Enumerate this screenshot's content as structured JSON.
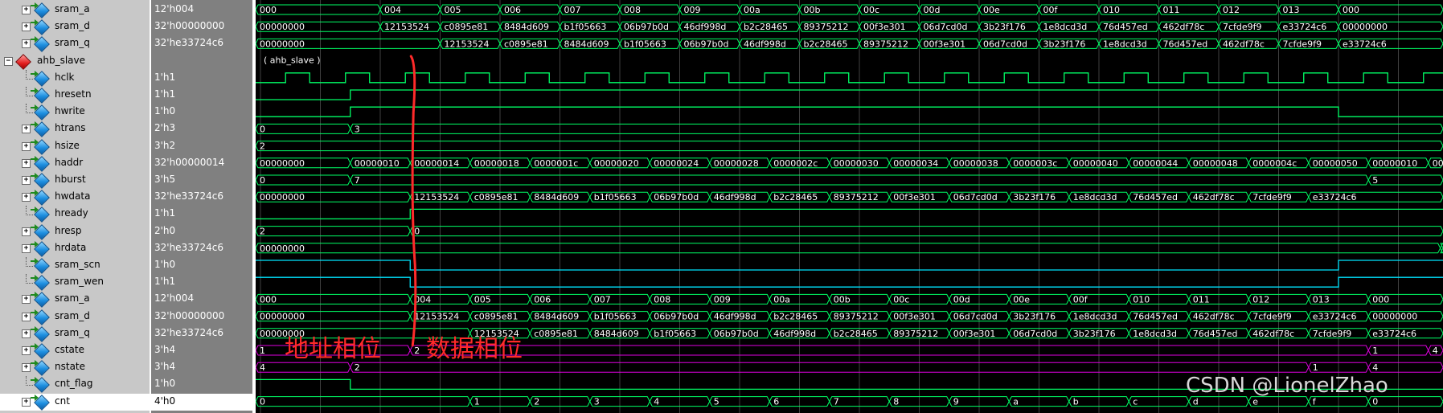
{
  "signals": [
    {
      "name": "sram_a",
      "value": "12'h004",
      "kind": "bus",
      "indent": 2,
      "color": "#00ff66",
      "segments": [
        [
          "000",
          0
        ],
        [
          "004",
          2
        ],
        [
          "005",
          3
        ],
        [
          "006",
          4
        ],
        [
          "007",
          5
        ],
        [
          "008",
          6
        ],
        [
          "009",
          7
        ],
        [
          "00a",
          8
        ],
        [
          "00b",
          9
        ],
        [
          "00c",
          10
        ],
        [
          "00d",
          11
        ],
        [
          "00e",
          12
        ],
        [
          "00f",
          13
        ],
        [
          "010",
          14
        ],
        [
          "011",
          15
        ],
        [
          "012",
          16
        ],
        [
          "013",
          17
        ],
        [
          "000",
          18
        ]
      ]
    },
    {
      "name": "sram_d",
      "value": "32'h00000000",
      "kind": "bus",
      "indent": 2,
      "color": "#00ff66",
      "segments": [
        [
          "00000000",
          0
        ],
        [
          "12153524",
          2
        ],
        [
          "c0895e81",
          3
        ],
        [
          "8484d609",
          4
        ],
        [
          "b1f05663",
          5
        ],
        [
          "06b97b0d",
          6
        ],
        [
          "46df998d",
          7
        ],
        [
          "b2c28465",
          8
        ],
        [
          "89375212",
          9
        ],
        [
          "00f3e301",
          10
        ],
        [
          "06d7cd0d",
          11
        ],
        [
          "3b23f176",
          12
        ],
        [
          "1e8dcd3d",
          13
        ],
        [
          "76d457ed",
          14
        ],
        [
          "462df78c",
          15
        ],
        [
          "7cfde9f9",
          16
        ],
        [
          "e33724c6",
          17
        ],
        [
          "00000000",
          18
        ]
      ]
    },
    {
      "name": "sram_q",
      "value": "32'he33724c6",
      "kind": "bus",
      "indent": 2,
      "color": "#00ff66",
      "segments": [
        [
          "00000000",
          0
        ],
        [
          "12153524",
          3
        ],
        [
          "c0895e81",
          4
        ],
        [
          "8484d609",
          5
        ],
        [
          "b1f05663",
          6
        ],
        [
          "06b97b0d",
          7
        ],
        [
          "46df998d",
          8
        ],
        [
          "b2c28465",
          9
        ],
        [
          "89375212",
          10
        ],
        [
          "00f3e301",
          11
        ],
        [
          "06d7cd0d",
          12
        ],
        [
          "3b23f176",
          13
        ],
        [
          "1e8dcd3d",
          14
        ],
        [
          "76d457ed",
          15
        ],
        [
          "462df78c",
          16
        ],
        [
          "7cfde9f9",
          17
        ],
        [
          "e33724c6",
          18
        ]
      ]
    },
    {
      "name": "ahb_slave",
      "value": "",
      "kind": "group",
      "indent": 0,
      "color": "#ffffff",
      "label": "( ahb_slave )"
    },
    {
      "name": "hclk",
      "value": "1'h1",
      "kind": "clock",
      "indent": 3,
      "color": "#00ff66"
    },
    {
      "name": "hresetn",
      "value": "1'h1",
      "kind": "bit",
      "indent": 3,
      "color": "#00ff66",
      "edges": [
        [
          0,
          0
        ],
        [
          1.5,
          1
        ]
      ]
    },
    {
      "name": "hwrite",
      "value": "1'h0",
      "kind": "bit",
      "indent": 3,
      "color": "#00ff66",
      "edges": [
        [
          0,
          0
        ],
        [
          1.5,
          1
        ],
        [
          18,
          0
        ]
      ]
    },
    {
      "name": "htrans",
      "value": "2'h3",
      "kind": "bus",
      "indent": 2,
      "color": "#00ff66",
      "segments": [
        [
          "0",
          0
        ],
        [
          "3",
          1.5
        ]
      ]
    },
    {
      "name": "hsize",
      "value": "3'h2",
      "kind": "bus",
      "indent": 2,
      "color": "#00ff66",
      "segments": [
        [
          "2",
          0
        ]
      ]
    },
    {
      "name": "haddr",
      "value": "32'h00000014",
      "kind": "bus",
      "indent": 2,
      "color": "#00ff66",
      "segments": [
        [
          "00000000",
          0
        ],
        [
          "00000010",
          1.5
        ],
        [
          "00000014",
          2.5
        ],
        [
          "00000018",
          3.5
        ],
        [
          "0000001c",
          4.5
        ],
        [
          "00000020",
          5.5
        ],
        [
          "00000024",
          6.5
        ],
        [
          "00000028",
          7.5
        ],
        [
          "0000002c",
          8.5
        ],
        [
          "00000030",
          9.5
        ],
        [
          "00000034",
          10.5
        ],
        [
          "00000038",
          11.5
        ],
        [
          "0000003c",
          12.5
        ],
        [
          "00000040",
          13.5
        ],
        [
          "00000044",
          14.5
        ],
        [
          "00000048",
          15.5
        ],
        [
          "0000004c",
          16.5
        ],
        [
          "00000050",
          17.5
        ],
        [
          "00000010",
          18.5
        ],
        [
          "00000",
          19.5
        ]
      ]
    },
    {
      "name": "hburst",
      "value": "3'h5",
      "kind": "bus",
      "indent": 2,
      "color": "#00ff66",
      "segments": [
        [
          "0",
          0
        ],
        [
          "7",
          1.5
        ],
        [
          "5",
          18.5
        ]
      ]
    },
    {
      "name": "hwdata",
      "value": "32'he33724c6",
      "kind": "bus",
      "indent": 2,
      "color": "#00ff66",
      "segments": [
        [
          "00000000",
          0
        ],
        [
          "12153524",
          2.5
        ],
        [
          "c0895e81",
          3.5
        ],
        [
          "8484d609",
          4.5
        ],
        [
          "b1f05663",
          5.5
        ],
        [
          "06b97b0d",
          6.5
        ],
        [
          "46df998d",
          7.5
        ],
        [
          "b2c28465",
          8.5
        ],
        [
          "89375212",
          9.5
        ],
        [
          "00f3e301",
          10.5
        ],
        [
          "06d7cd0d",
          11.5
        ],
        [
          "3b23f176",
          12.5
        ],
        [
          "1e8dcd3d",
          13.5
        ],
        [
          "76d457ed",
          14.5
        ],
        [
          "462df78c",
          15.5
        ],
        [
          "7cfde9f9",
          16.5
        ],
        [
          "e33724c6",
          17.5
        ]
      ]
    },
    {
      "name": "hready",
      "value": "1'h1",
      "kind": "bit",
      "indent": 3,
      "color": "#00ff66",
      "edges": [
        [
          0,
          0
        ],
        [
          2.5,
          1
        ]
      ]
    },
    {
      "name": "hresp",
      "value": "2'h0",
      "kind": "bus",
      "indent": 2,
      "color": "#00ff66",
      "segments": [
        [
          "2",
          0
        ],
        [
          "0",
          2.5
        ]
      ]
    },
    {
      "name": "hrdata",
      "value": "32'he33724c6",
      "kind": "bus",
      "indent": 2,
      "color": "#00ff66",
      "segments": [
        [
          "00000000",
          0
        ],
        [
          "e3",
          19.7
        ]
      ]
    },
    {
      "name": "sram_scn",
      "value": "1'h0",
      "kind": "bit",
      "indent": 3,
      "color": "#00e5ff",
      "edges": [
        [
          0,
          1
        ],
        [
          2.5,
          0
        ],
        [
          18,
          1
        ]
      ]
    },
    {
      "name": "sram_wen",
      "value": "1'h1",
      "kind": "bit",
      "indent": 3,
      "color": "#00e5ff",
      "edges": [
        [
          0,
          1
        ],
        [
          2.5,
          0
        ],
        [
          18,
          1
        ]
      ]
    },
    {
      "name": "sram_a",
      "value": "12'h004",
      "kind": "bus",
      "indent": 2,
      "color": "#00ff66",
      "segments": [
        [
          "000",
          0
        ],
        [
          "004",
          2.5
        ],
        [
          "005",
          3.5
        ],
        [
          "006",
          4.5
        ],
        [
          "007",
          5.5
        ],
        [
          "008",
          6.5
        ],
        [
          "009",
          7.5
        ],
        [
          "00a",
          8.5
        ],
        [
          "00b",
          9.5
        ],
        [
          "00c",
          10.5
        ],
        [
          "00d",
          11.5
        ],
        [
          "00e",
          12.5
        ],
        [
          "00f",
          13.5
        ],
        [
          "010",
          14.5
        ],
        [
          "011",
          15.5
        ],
        [
          "012",
          16.5
        ],
        [
          "013",
          17.5
        ],
        [
          "000",
          18.5
        ]
      ]
    },
    {
      "name": "sram_d",
      "value": "32'h00000000",
      "kind": "bus",
      "indent": 2,
      "color": "#00ff66",
      "segments": [
        [
          "00000000",
          0
        ],
        [
          "12153524",
          2.5
        ],
        [
          "c0895e81",
          3.5
        ],
        [
          "8484d609",
          4.5
        ],
        [
          "b1f05663",
          5.5
        ],
        [
          "06b97b0d",
          6.5
        ],
        [
          "46df998d",
          7.5
        ],
        [
          "b2c28465",
          8.5
        ],
        [
          "89375212",
          9.5
        ],
        [
          "00f3e301",
          10.5
        ],
        [
          "06d7cd0d",
          11.5
        ],
        [
          "3b23f176",
          12.5
        ],
        [
          "1e8dcd3d",
          13.5
        ],
        [
          "76d457ed",
          14.5
        ],
        [
          "462df78c",
          15.5
        ],
        [
          "7cfde9f9",
          16.5
        ],
        [
          "e33724c6",
          17.5
        ],
        [
          "00000000",
          18.5
        ]
      ]
    },
    {
      "name": "sram_q",
      "value": "32'he33724c6",
      "kind": "bus",
      "indent": 2,
      "color": "#00ff66",
      "segments": [
        [
          "00000000",
          0
        ],
        [
          "12153524",
          3.5
        ],
        [
          "c0895e81",
          4.5
        ],
        [
          "8484d609",
          5.5
        ],
        [
          "b1f05663",
          6.5
        ],
        [
          "06b97b0d",
          7.5
        ],
        [
          "46df998d",
          8.5
        ],
        [
          "b2c28465",
          9.5
        ],
        [
          "89375212",
          10.5
        ],
        [
          "00f3e301",
          11.5
        ],
        [
          "06d7cd0d",
          12.5
        ],
        [
          "3b23f176",
          13.5
        ],
        [
          "1e8dcd3d",
          14.5
        ],
        [
          "76d457ed",
          15.5
        ],
        [
          "462df78c",
          16.5
        ],
        [
          "7cfde9f9",
          17.5
        ],
        [
          "e33724c6",
          18.5
        ]
      ]
    },
    {
      "name": "cstate",
      "value": "3'h4",
      "kind": "bus",
      "indent": 2,
      "color": "#e000e0",
      "segments": [
        [
          "1",
          0
        ],
        [
          "2",
          2.5
        ],
        [
          "1",
          18.5
        ],
        [
          "4",
          19.5
        ]
      ]
    },
    {
      "name": "nstate",
      "value": "3'h4",
      "kind": "bus",
      "indent": 2,
      "color": "#e000e0",
      "segments": [
        [
          "4",
          0
        ],
        [
          "2",
          1.5
        ],
        [
          "1",
          17.5
        ],
        [
          "4",
          18.5
        ]
      ]
    },
    {
      "name": "cnt_flag",
      "value": "1'h0",
      "kind": "bit",
      "indent": 3,
      "color": "#00ff66",
      "edges": [
        [
          0,
          1
        ],
        [
          1.5,
          0
        ]
      ]
    },
    {
      "name": "cnt",
      "value": "4'h0",
      "kind": "bus",
      "indent": 2,
      "color": "#00ff66",
      "selected": true,
      "segments": [
        [
          "0",
          0
        ],
        [
          "1",
          3.5
        ],
        [
          "2",
          4.5
        ],
        [
          "3",
          5.5
        ],
        [
          "4",
          6.5
        ],
        [
          "5",
          7.5
        ],
        [
          "6",
          8.5
        ],
        [
          "7",
          9.5
        ],
        [
          "8",
          10.5
        ],
        [
          "9",
          11.5
        ],
        [
          "a",
          12.5
        ],
        [
          "b",
          13.5
        ],
        [
          "c",
          14.5
        ],
        [
          "d",
          15.5
        ],
        [
          "e",
          16.5
        ],
        [
          "f",
          17.5
        ],
        [
          "0",
          18.5
        ]
      ]
    }
  ],
  "annotations": {
    "address_phase": "地址相位",
    "data_phase": "数据相位",
    "address_phase_color": "#ff2a2a"
  },
  "watermark": "CSDN @LionelZhao",
  "colors": {
    "grid": "#404040",
    "bus": "#00ff66",
    "divider": "#ff2a2a"
  }
}
